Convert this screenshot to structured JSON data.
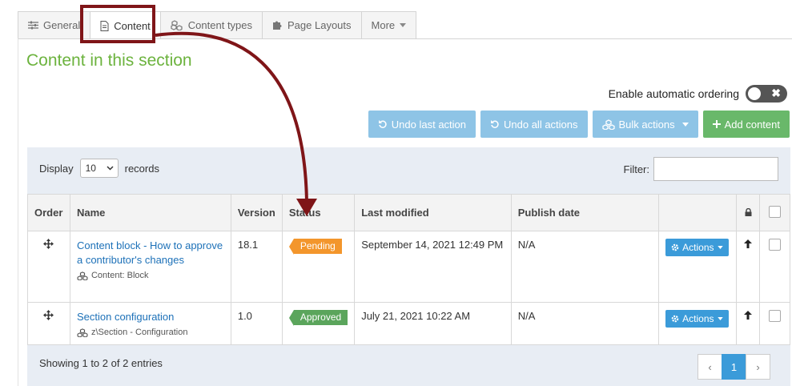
{
  "tabs": [
    {
      "label": "General",
      "icon": "sliders-icon"
    },
    {
      "label": "Content",
      "icon": "document-icon"
    },
    {
      "label": "Content types",
      "icon": "cubes-icon"
    },
    {
      "label": "Page Layouts",
      "icon": "puzzle-icon"
    },
    {
      "label": "More",
      "icon": "caret-down-icon"
    }
  ],
  "section_title": "Content in this section",
  "auto_ordering": {
    "label": "Enable automatic ordering",
    "toggle_symbol": "✖"
  },
  "buttons": {
    "undo_last": "Undo last action",
    "undo_all": "Undo all actions",
    "bulk": "Bulk actions",
    "add": "Add content"
  },
  "display": {
    "prefix": "Display",
    "value": "10",
    "suffix": "records"
  },
  "filter": {
    "label": "Filter:",
    "value": ""
  },
  "table": {
    "headers": [
      "Order",
      "Name",
      "Version",
      "Status",
      "Last modified",
      "Publish date",
      "",
      "",
      ""
    ],
    "rows": [
      {
        "name": "Content block - How to approve a contributor's changes",
        "type": "Content: Block",
        "version": "18.1",
        "status": "Pending",
        "last_modified": "September 14, 2021 12:49 PM",
        "publish_date": "N/A",
        "actions": "Actions"
      },
      {
        "name": "Section configuration",
        "type": "z\\Section - Configuration",
        "version": "1.0",
        "status": "Approved",
        "last_modified": "July 21, 2021 10:22 AM",
        "publish_date": "N/A",
        "actions": "Actions"
      }
    ]
  },
  "showing": "Showing 1 to 2 of 2 entries",
  "pager": {
    "prev": "‹",
    "current": "1",
    "next": "›"
  },
  "colors": {
    "accent_green": "#6cb33e",
    "link_blue": "#1d71b8",
    "annotation_red": "#7f1518",
    "pending": "#f3962c",
    "approved": "#5ba55c"
  }
}
